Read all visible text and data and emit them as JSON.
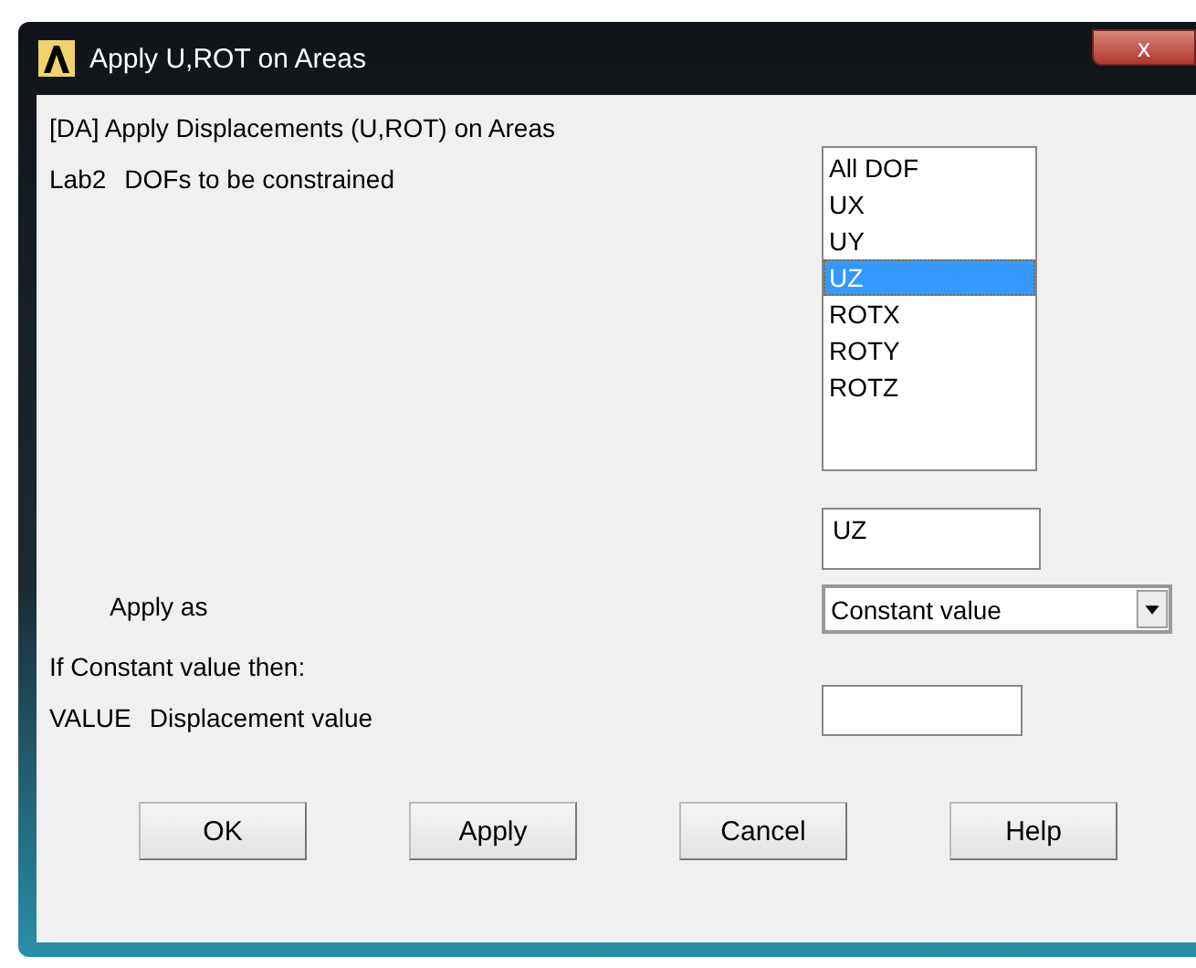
{
  "window": {
    "title": "Apply U,ROT on Areas",
    "close": "x"
  },
  "heading": "[DA]  Apply Displacements (U,ROT) on Areas",
  "dofs": {
    "label": "Lab2",
    "description": "DOFs to be constrained",
    "options": [
      {
        "label": "All DOF",
        "selected": false
      },
      {
        "label": "UX",
        "selected": false
      },
      {
        "label": "UY",
        "selected": false
      },
      {
        "label": "UZ",
        "selected": true
      },
      {
        "label": "ROTX",
        "selected": false
      },
      {
        "label": "ROTY",
        "selected": false
      },
      {
        "label": "ROTZ",
        "selected": false
      }
    ],
    "value": "UZ"
  },
  "apply_as": {
    "label": "Apply as",
    "value": "Constant value"
  },
  "note": "If Constant value then:",
  "value_field": {
    "label": "VALUE",
    "description": "Displacement value"
  },
  "buttons": [
    "OK",
    "Apply",
    "Cancel",
    "Help"
  ]
}
